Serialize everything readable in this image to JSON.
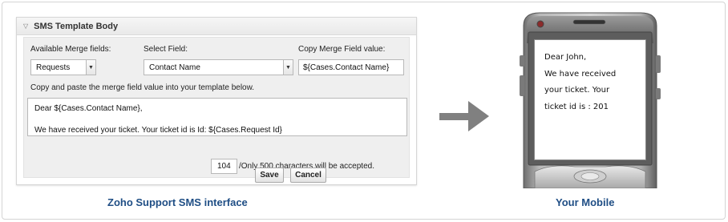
{
  "panel": {
    "title": "SMS Template Body",
    "merge_fields_label": "Available Merge fields:",
    "merge_fields_value": "Requests",
    "select_field_label": "Select Field:",
    "select_field_value": "Contact Name",
    "copy_value_label": "Copy Merge Field value:",
    "copy_value_text": "${Cases.Contact Name}",
    "instructions": "Copy and paste the merge field value into your template below.",
    "template_line1": "Dear ${Cases.Contact Name},",
    "template_line2": "We have received your ticket. Your ticket id is  Id: ${Cases.Request Id}",
    "char_count": "104",
    "char_limit_text": "/Only 500 characters will be accepted.",
    "save_label": "Save",
    "cancel_label": "Cancel"
  },
  "captions": {
    "left": "Zoho Support SMS interface",
    "right": "Your Mobile"
  },
  "phone": {
    "line1": "Dear John,",
    "line2": "We have received",
    "line3": "your ticket. Your",
    "line4": "ticket id is : 201"
  },
  "colors": {
    "caption": "#1f4e85",
    "arrow": "#808080",
    "panel_bg": "#efefef"
  },
  "icons": {
    "collapse": "triangle-down-icon",
    "dropdown": "chevron-down-icon",
    "arrow": "arrow-right-icon"
  }
}
